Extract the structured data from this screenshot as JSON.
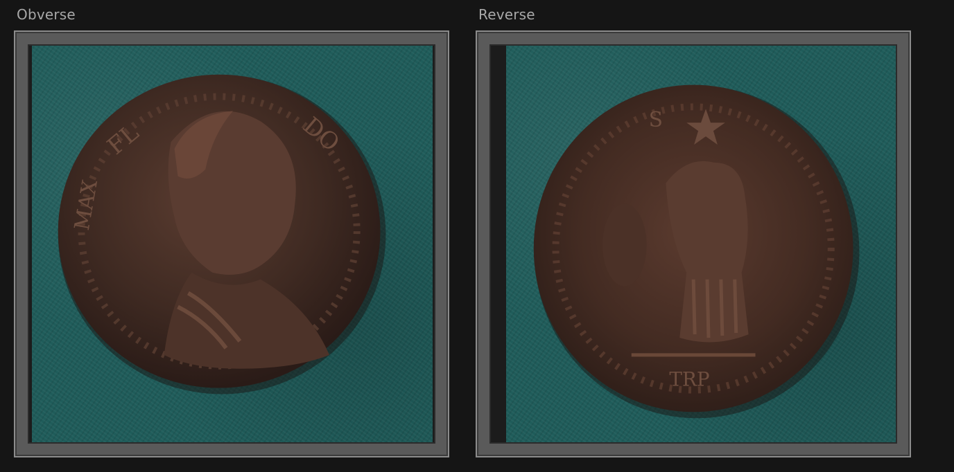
{
  "panels": {
    "obverse": {
      "title": "Obverse",
      "image_icon": "coin-obverse-photo"
    },
    "reverse": {
      "title": "Reverse",
      "image_icon": "coin-reverse-photo"
    }
  },
  "colors": {
    "background": "#151515",
    "frame": "#5a5a5a",
    "felt": "#1f5c5a",
    "coin": "#4a3128",
    "title_text": "#a8a8a8"
  }
}
